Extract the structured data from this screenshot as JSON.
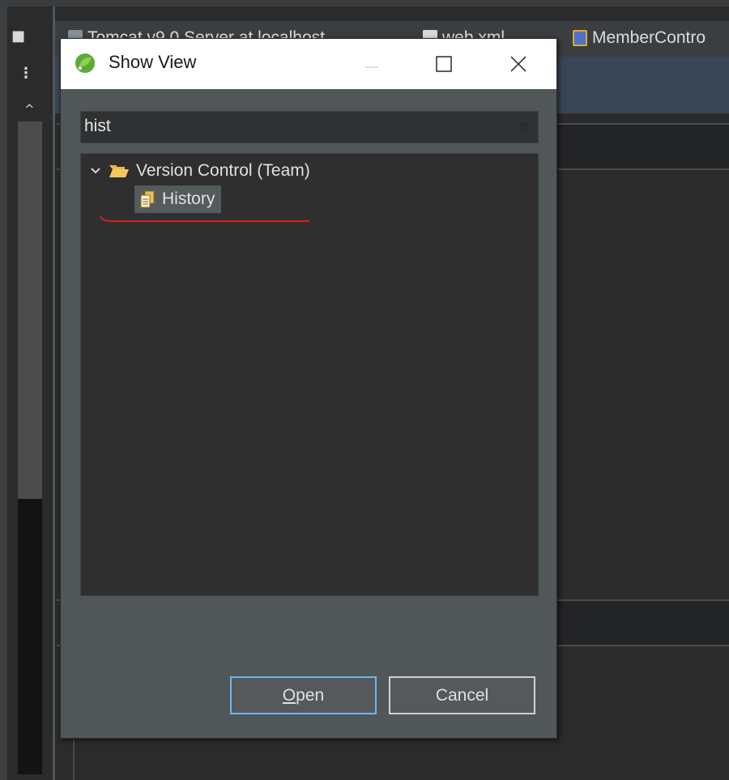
{
  "ide": {
    "tabs": [
      {
        "label": "Tomcat v9.0 Server at localhost",
        "icon": "server-icon"
      },
      {
        "label": "web.xml",
        "icon": "xml-file-icon"
      },
      {
        "label": "MemberContro",
        "icon": "java-file-icon"
      }
    ]
  },
  "dialog": {
    "title": "Show View",
    "logo_icon": "spring-logo-icon",
    "controls": {
      "minimize": "minimize-icon",
      "maximize": "maximize-icon",
      "close": "close-icon"
    },
    "filter": {
      "value": "hist",
      "clear_icon": "clear-icon"
    },
    "tree": {
      "category": {
        "label": "Version Control (Team)",
        "expanded": true,
        "icon": "folder-open-icon"
      },
      "items": [
        {
          "label": "History",
          "icon": "history-view-icon",
          "selected": true
        }
      ]
    },
    "buttons": {
      "open_mnemonic": "O",
      "open_rest": "pen",
      "cancel": "Cancel"
    }
  },
  "colors": {
    "dialog_bg": "#515658",
    "tree_bg": "#2f2f2f",
    "selection": "#555a5d",
    "annotation": "#d42020",
    "default_button_border": "#6fb5ec"
  }
}
